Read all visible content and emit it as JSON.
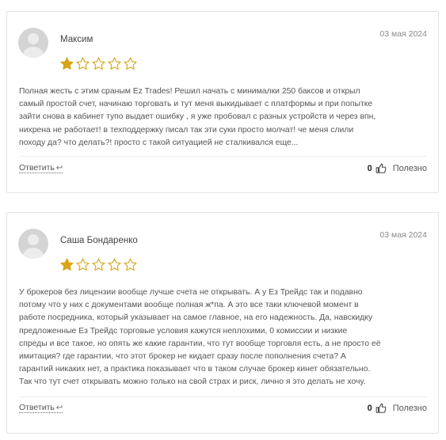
{
  "reviews": [
    {
      "author": "Максим",
      "date": "03 мая 2024",
      "rating": 1,
      "rating_max": 5,
      "lines": [
        "Полная жесть с этим сраным Ez Trades! Решил начать с минималки 250 баксов и открыл",
        "самый простой счет, начинаю торговать и тут меня выкидывает с платформы и при попытке",
        "зайти снова в кабинет тупо выдает ошибку , я уже пробовал с разных устройств и через впн,",
        "нихрена не работает! в техподдержку писал так эти суки просто молчат! че меня слили",
        "походу да? что делать?! просто с такой ситуацией не сталкивался еще..."
      ],
      "reply_label": "Ответить",
      "votes": "0",
      "useful_label": "Полезно"
    },
    {
      "author": "Саша Бондаренко",
      "date": "03 мая 2024",
      "rating": 1,
      "rating_max": 5,
      "lines": [
        "У брокеров без лицензии вообще лучше счета не открывать. А у Ез Трейдс так и подавно",
        "потому что у них с документами вообще полная ж*па. А это все таки ключевой момент в",
        "работе посредника, который указывает на самое главное, на его надежность. Да, навскидку",
        "предложенные Ез Трейдс торговые условия кажутся неплохими, 0 комиссии и низкие",
        "спреды и все такое, но опять же какие гарантии, что тут вообще торговля есть, а не просто её",
        "имитация? где гарантии, что этот брокер не кидает сразу после пополнения счета? А",
        "гарантий никаких нет, а практика показывает что в таком случае брокер кинет обязательно.",
        "Так что тут счет открывать можно только на свой страх и риск, лично я это делать не хочу."
      ],
      "reply_label": "Ответить",
      "votes": "0",
      "useful_label": "Полезно"
    }
  ],
  "colors": {
    "star_filled": "#d9a514",
    "star_empty_stroke": "#d9a514",
    "text": "#555555",
    "border": "#e3e3e3"
  },
  "icons": {
    "reply": "reply-arrow-icon",
    "vote": "thumbs-up-icon",
    "avatar": "user-avatar-icon"
  }
}
